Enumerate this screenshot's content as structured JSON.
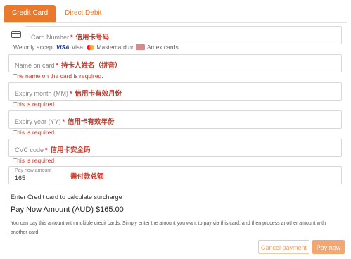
{
  "tabs": [
    {
      "label": "Credit Card",
      "active": true
    },
    {
      "label": "Direct Debit",
      "active": false
    }
  ],
  "card_number": {
    "placeholder": "Card Number",
    "required_mark": "*",
    "annotation": "信用卡号码"
  },
  "accepted": {
    "prefix": "We only accept",
    "visa_logo": "VISA",
    "visa": "Visa,",
    "mastercard": "Mastercard or",
    "amex": "Amex cards"
  },
  "name_on_card": {
    "placeholder": "Name on card",
    "required_mark": "*",
    "annotation": "持卡人姓名（拼音）",
    "error": "The name on the card is required."
  },
  "expiry_month": {
    "placeholder": "Expiry month (MM)",
    "required_mark": "*",
    "annotation": "信用卡有效月份",
    "error": "This is required"
  },
  "expiry_year": {
    "placeholder": "Expiry year (YY)",
    "required_mark": "*",
    "annotation": "信用卡有效年份",
    "error": "This is required"
  },
  "cvc": {
    "placeholder": "CVC code",
    "required_mark": "*",
    "annotation": "信用卡安全码",
    "error": "This is required"
  },
  "pay_now_field": {
    "label": "Pay now amount",
    "value": "165",
    "annotation": "需付款总额"
  },
  "surcharge_text": "Enter Credit card to calculate surcharge",
  "pay_now_amount": "Pay Now Amount (AUD) $165.00",
  "description": "You can pay this amount with multiple credit cards. Simply enter the amount you want to pay via this card, and then process another amount with another card.",
  "buttons": {
    "cancel": "Cancel payment",
    "pay": "Pay now"
  },
  "colors": {
    "accent": "#e8792d",
    "error": "#c0392b",
    "annotation": "#c0392b"
  },
  "icons": {
    "card": "credit-card-icon",
    "mastercard": "mastercard-logo",
    "amex": "amex-logo"
  }
}
